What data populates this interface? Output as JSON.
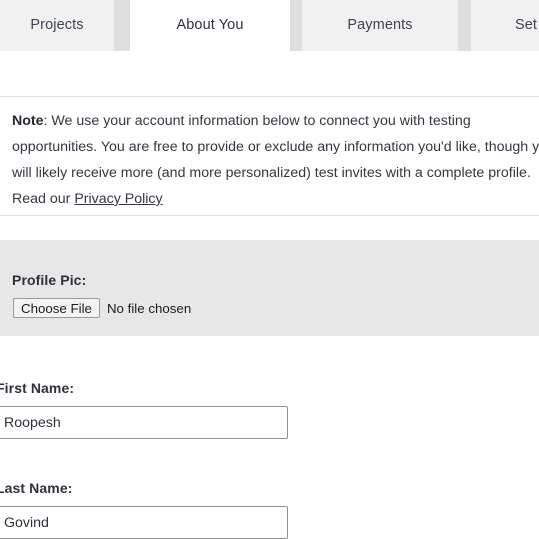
{
  "tabs": [
    {
      "id": "projects",
      "label": "Projects",
      "active": false
    },
    {
      "id": "about-you",
      "label": "About You",
      "active": true
    },
    {
      "id": "payments",
      "label": "Payments",
      "active": false
    },
    {
      "id": "settings",
      "label": "Set",
      "active": false
    }
  ],
  "note": {
    "lead": "Note",
    "lead_separator": ": ",
    "body_before_link": "We use your account information below to connect you with testing opportunities. You are free to provide or exclude any information you'd like, though you will likely receive more (and more personalized) test invites with a complete profile. Read our ",
    "link_text": "Privacy Policy"
  },
  "profile_pic": {
    "label": "Profile Pic:",
    "button_label": "Choose File",
    "file_status": "No file chosen"
  },
  "fields": {
    "first_name": {
      "label": "First Name:",
      "value": "Roopesh",
      "placeholder": ""
    },
    "last_name": {
      "label": "Last Name:",
      "value": "Govind",
      "placeholder": ""
    }
  },
  "colors": {
    "tab_inactive_bg": "#f1f1f1",
    "tab_active_bg": "#ffffff",
    "tab_gap": "#dedede",
    "panel_grey": "#e7e7e7",
    "rule": "#e3e3e3",
    "text": "#33373f",
    "input_border": "#8f8f8f"
  }
}
